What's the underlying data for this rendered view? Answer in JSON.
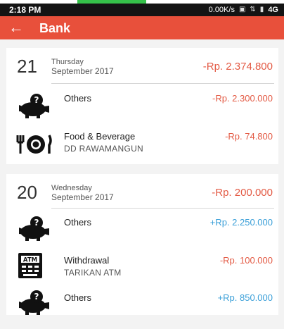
{
  "status_bar": {
    "time": "2:18 PM",
    "speed": "0.00K/s",
    "network": "4G"
  },
  "app_bar": {
    "back_icon": "arrow-left-icon",
    "title": "Bank"
  },
  "colors": {
    "app_bar": "#e8503b",
    "negative": "#e35a44",
    "positive": "#3a9fd8"
  },
  "days": [
    {
      "day": "21",
      "weekday": "Thursday",
      "month_year": "September 2017",
      "total": "-Rp. 2.374.800",
      "transactions": [
        {
          "icon": "piggy-bank-question-icon",
          "label": "Others",
          "sub": "",
          "amount": "-Rp. 2.300.000"
        },
        {
          "icon": "fork-knife-plate-icon",
          "label": "Food & Beverage",
          "sub": "DD RAWAMANGUN",
          "amount": "-Rp. 74.800"
        }
      ]
    },
    {
      "day": "20",
      "weekday": "Wednesday",
      "month_year": "September 2017",
      "total": "-Rp. 200.000",
      "transactions": [
        {
          "icon": "piggy-bank-question-icon",
          "label": "Others",
          "sub": "",
          "amount": "+Rp. 2.250.000"
        },
        {
          "icon": "atm-icon",
          "label": "Withdrawal",
          "sub": "TARIKAN ATM",
          "amount": "-Rp. 100.000"
        },
        {
          "icon": "piggy-bank-question-icon",
          "label": "Others",
          "sub": "",
          "amount": "+Rp. 850.000"
        }
      ]
    }
  ]
}
